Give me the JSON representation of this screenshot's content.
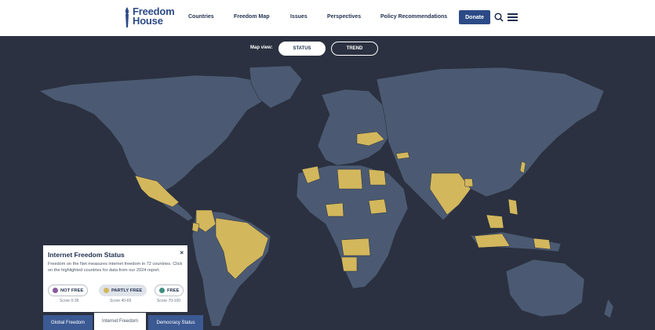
{
  "header": {
    "logo_line1": "Freedom",
    "logo_line2": "House",
    "nav": [
      {
        "label": "Countries"
      },
      {
        "label": "Freedom Map"
      },
      {
        "label": "Issues"
      },
      {
        "label": "Perspectives"
      },
      {
        "label": "Policy Recommendations"
      }
    ],
    "donate_label": "Donate"
  },
  "map_view": {
    "label": "Map view:",
    "options": [
      {
        "label": "STATUS",
        "selected": true
      },
      {
        "label": "TREND",
        "selected": false
      }
    ]
  },
  "colors": {
    "header_bg": "#ffffff",
    "brand": "#2c4a86",
    "map_bg": "#2b3140",
    "land_default": "#4b5a72",
    "partly_free": "#d3b75c",
    "not_free": "#8a5a9b",
    "free": "#3f8f7f"
  },
  "legend": {
    "title": "Internet Freedom Status",
    "description": "Freedom on the Net measures internet freedom in 72 countries. Click on the highlighted countries for data from our 2024 report.",
    "close_symbol": "×",
    "items": [
      {
        "label": "NOT FREE",
        "score": "Score 0-39",
        "color": "#8a5a9b"
      },
      {
        "label": "PARTLY FREE",
        "score": "Score 40-69",
        "color": "#d3b75c",
        "active": true
      },
      {
        "label": "FREE",
        "score": "Score 70-100",
        "color": "#3f8f7f"
      }
    ]
  },
  "tabs": [
    {
      "label": "Global Freedom"
    },
    {
      "label": "Internet Freedom",
      "selected": true
    },
    {
      "label": "Democracy Status"
    }
  ],
  "icons": {
    "search": "search-icon",
    "menu": "hamburger-menu-icon",
    "logo": "torch-icon"
  }
}
